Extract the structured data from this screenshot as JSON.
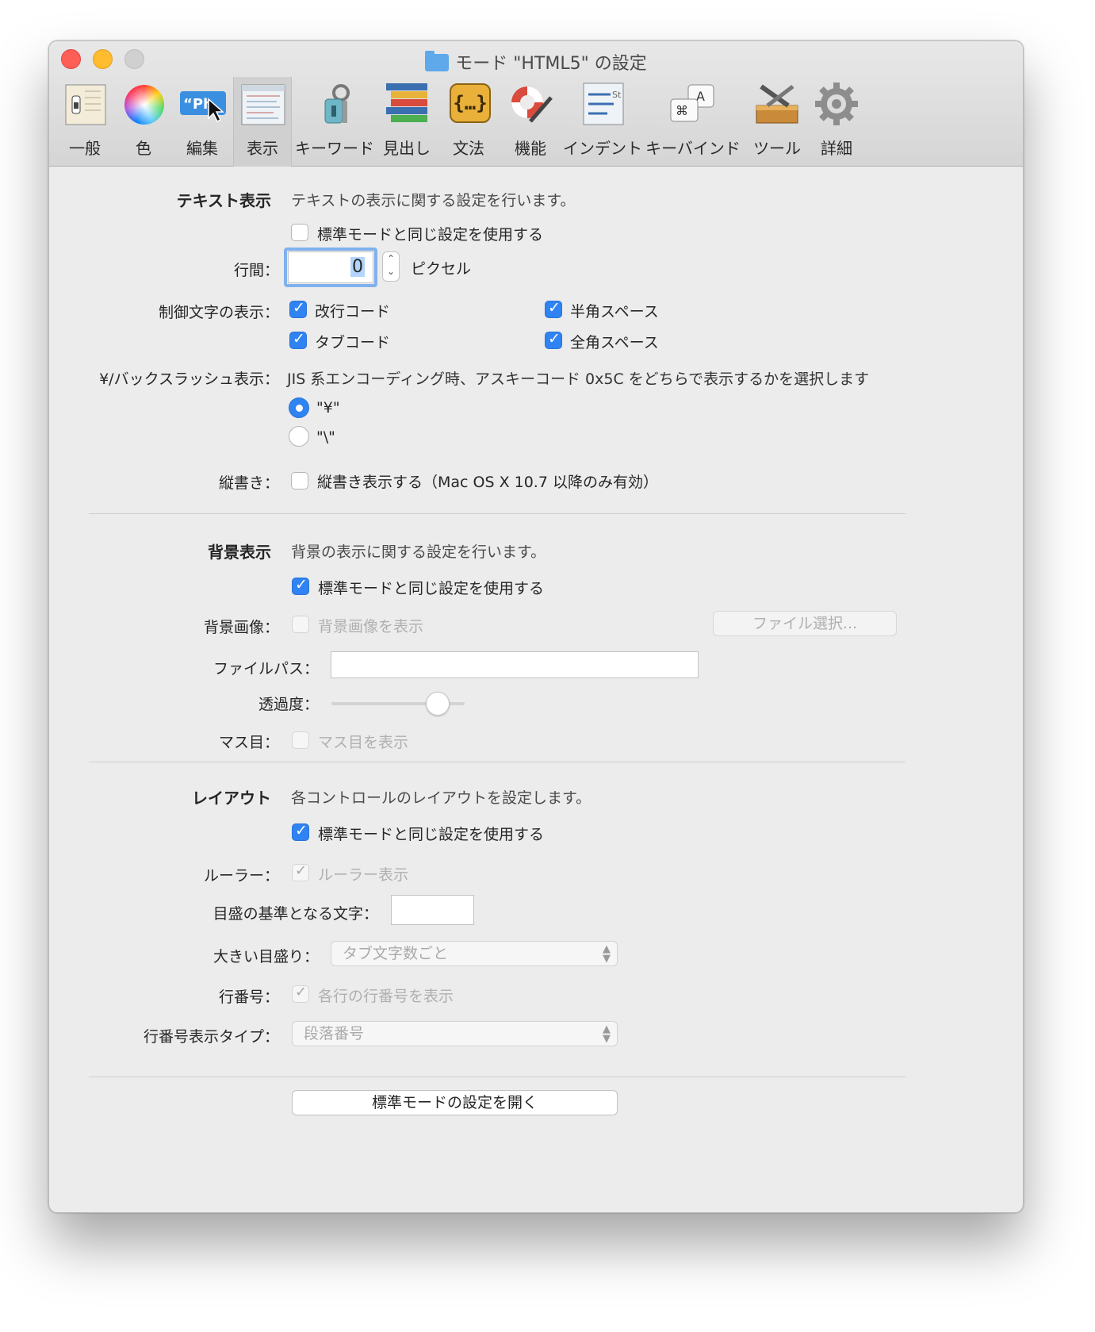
{
  "window": {
    "title": "モード \"HTML5\" の設定"
  },
  "toolbar": [
    {
      "label": "一般",
      "icon": "switch-icon"
    },
    {
      "label": "色",
      "icon": "color-wheel-icon"
    },
    {
      "label": "編集",
      "icon": "phrase-cursor-icon"
    },
    {
      "label": "表示",
      "icon": "document-view-icon",
      "selected": true
    },
    {
      "label": "キーワード",
      "icon": "keychain-icon"
    },
    {
      "label": "見出し",
      "icon": "section-headers-icon"
    },
    {
      "label": "文法",
      "icon": "braces-icon"
    },
    {
      "label": "機能",
      "icon": "lifebuoy-pen-icon"
    },
    {
      "label": "インデント",
      "icon": "indent-icon"
    },
    {
      "label": "キーバインド",
      "icon": "keyboard-keys-icon"
    },
    {
      "label": "ツール",
      "icon": "toolbox-icon"
    },
    {
      "label": "詳細",
      "icon": "gear-icon"
    }
  ],
  "text_display": {
    "section": "テキスト表示",
    "description": "テキストの表示に関する設定を行います。",
    "use_default": "標準モードと同じ設定を使用する",
    "line_spacing_label": "行間：",
    "line_spacing_value": "0",
    "line_spacing_unit": "ピクセル",
    "control_chars_label": "制御文字の表示：",
    "newline": "改行コード",
    "halfwidth_space": "半角スペース",
    "tab": "タブコード",
    "fullwidth_space": "全角スペース",
    "yen_label": "¥/バックスラッシュ表示：",
    "yen_desc": "JIS 系エンコーディング時、アスキーコード 0x5C をどちらで表示するかを選択します",
    "yen_option": "\"¥\"",
    "backslash_option": "\"\\\"",
    "vertical_label": "縦書き：",
    "vertical_option": "縦書き表示する（Mac OS X 10.7 以降のみ有効）"
  },
  "background": {
    "section": "背景表示",
    "description": "背景の表示に関する設定を行います。",
    "use_default": "標準モードと同じ設定を使用する",
    "image_label": "背景画像：",
    "image_option": "背景画像を表示",
    "file_button": "ファイル選択...",
    "file_path_label": "ファイルパス：",
    "file_path_value": "",
    "opacity_label": "透過度：",
    "opacity_value": 0.8,
    "grid_label": "マス目：",
    "grid_option": "マス目を表示"
  },
  "layout": {
    "section": "レイアウト",
    "description": "各コントロールのレイアウトを設定します。",
    "use_default": "標準モードと同じ設定を使用する",
    "ruler_label": "ルーラー：",
    "ruler_option": "ルーラー表示",
    "scale_char_label": "目盛の基準となる文字：",
    "scale_char_value": "",
    "major_tick_label": "大きい目盛り：",
    "major_tick_value": "タブ文字数ごと",
    "line_number_label": "行番号：",
    "line_number_option": "各行の行番号を表示",
    "line_number_type_label": "行番号表示タイプ：",
    "line_number_type_value": "段落番号"
  },
  "footer": {
    "open_default_button": "標準モードの設定を開く"
  }
}
